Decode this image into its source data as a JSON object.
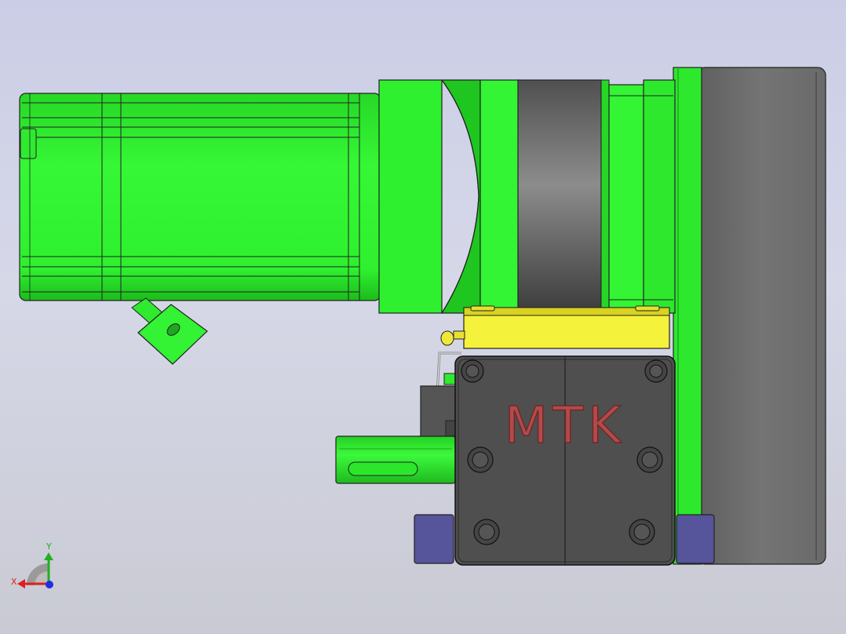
{
  "viewport": {
    "background_top": "#cbcde6",
    "background_bottom": "#c9cad3"
  },
  "model": {
    "emboss_text": "MTK",
    "colors": {
      "green": "#33f533",
      "green_dark": "#1fbf1f",
      "grey": "#6e6e6e",
      "grey_dark": "#4a4a4a",
      "yellow": "#f4f23a",
      "navy": "#56549a",
      "emboss": "#b34a4a"
    }
  },
  "triad": {
    "x_label": "X",
    "y_label": "Y",
    "x_color": "#e02020",
    "y_color": "#20b020",
    "z_color": "#2030e0"
  }
}
